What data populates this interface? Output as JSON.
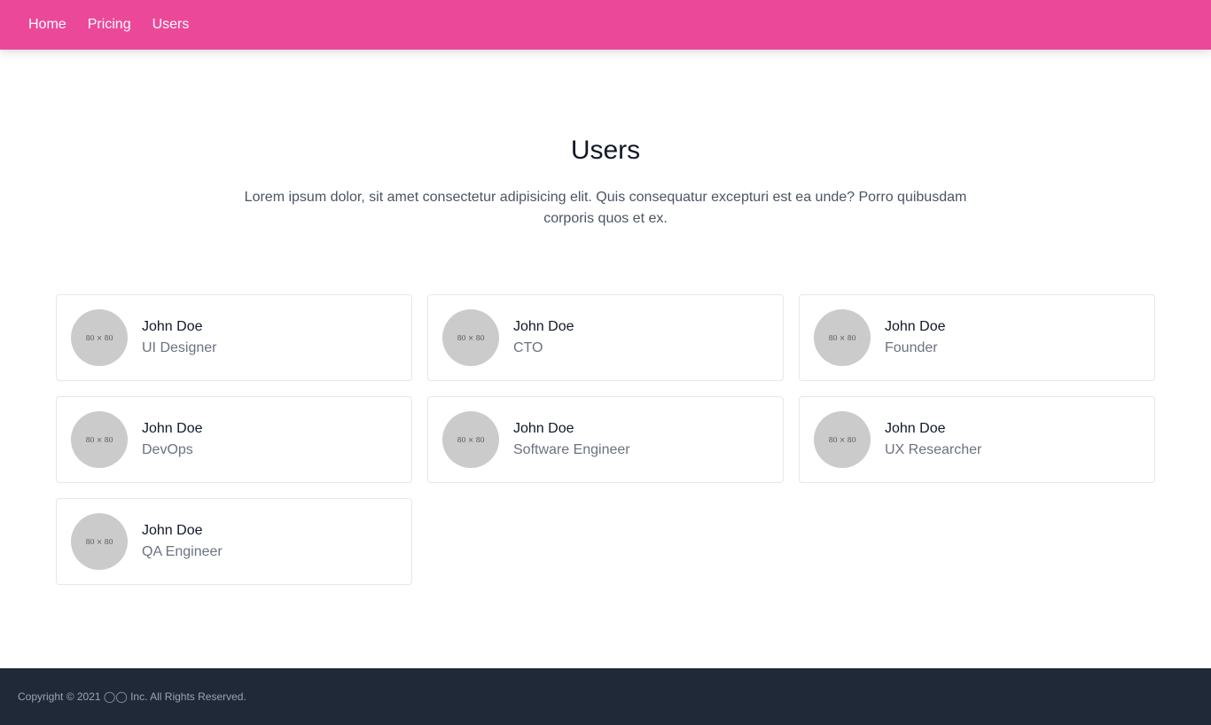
{
  "nav": {
    "links": [
      "Home",
      "Pricing",
      "Users"
    ]
  },
  "header": {
    "title": "Users",
    "subtitle": "Lorem ipsum dolor, sit amet consectetur adipisicing elit. Quis consequatur excepturi est ea unde? Porro quibusdam corporis quos et ex."
  },
  "users": [
    {
      "name": "John Doe",
      "role": "UI Designer",
      "avatar_label": "80 × 80"
    },
    {
      "name": "John Doe",
      "role": "CTO",
      "avatar_label": "80 × 80"
    },
    {
      "name": "John Doe",
      "role": "Founder",
      "avatar_label": "80 × 80"
    },
    {
      "name": "John Doe",
      "role": "DevOps",
      "avatar_label": "80 × 80"
    },
    {
      "name": "John Doe",
      "role": "Software Engineer",
      "avatar_label": "80 × 80"
    },
    {
      "name": "John Doe",
      "role": "UX Researcher",
      "avatar_label": "80 × 80"
    },
    {
      "name": "John Doe",
      "role": "QA Engineer",
      "avatar_label": "80 × 80"
    }
  ],
  "footer": {
    "copyright": "Copyright © 2021 ◯◯ Inc. All Rights Reserved."
  },
  "colors": {
    "brand": "#ec4899",
    "footer_bg": "#1f2937"
  }
}
